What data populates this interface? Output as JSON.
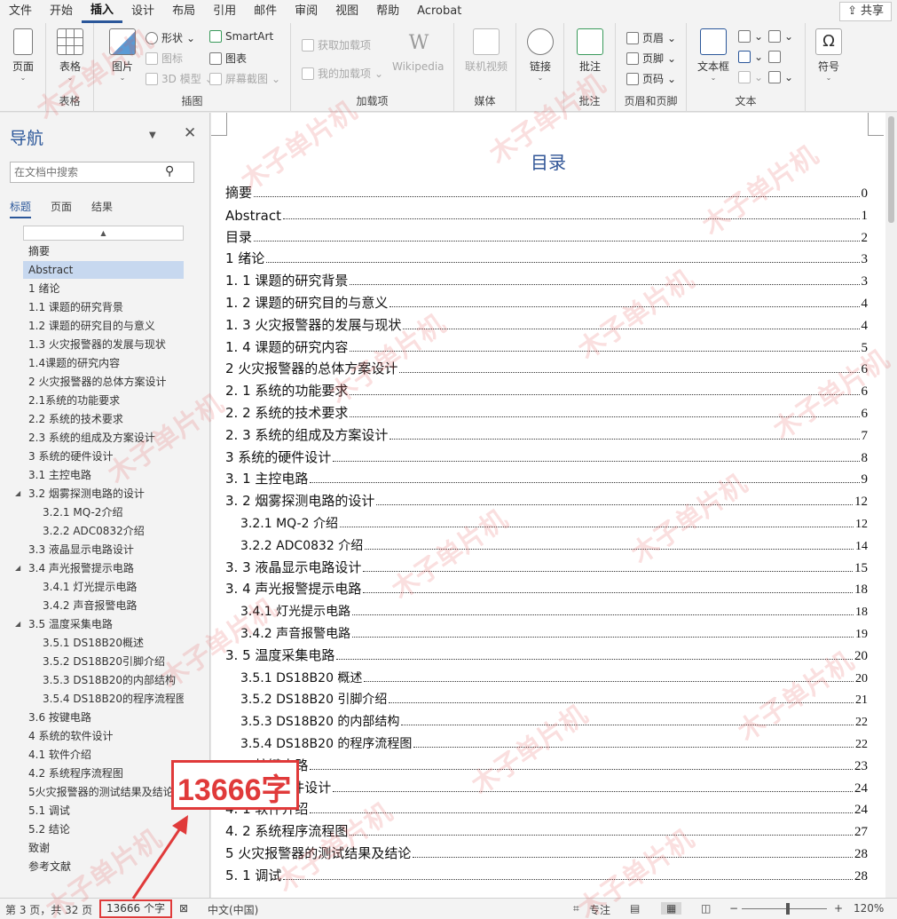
{
  "menu": {
    "items": [
      "文件",
      "开始",
      "插入",
      "设计",
      "布局",
      "引用",
      "邮件",
      "审阅",
      "视图",
      "帮助",
      "Acrobat"
    ],
    "active_index": 2,
    "share_label": "共享"
  },
  "ribbon": {
    "pages": {
      "label": "页面",
      "group": ""
    },
    "table": {
      "label": "表格",
      "group": "表格"
    },
    "picture": {
      "label": "图片"
    },
    "shapes": "形状",
    "icons": "图标",
    "model3d": "3D 模型",
    "smartart": "SmartArt",
    "chart": "图表",
    "screenshot": "屏幕截图",
    "illustrations_group": "插图",
    "get_addins": "获取加载项",
    "my_addins": "我的加载项",
    "wikipedia_logo": "W",
    "wikipedia": "Wikipedia",
    "addins_group": "加载项",
    "online_video": "联机视频",
    "media_group": "媒体",
    "link": "链接",
    "comment": "批注",
    "comment_group": "批注",
    "header": "页眉",
    "footer": "页脚",
    "page_number": "页码",
    "header_footer_group": "页眉和页脚",
    "textbox": "文本框",
    "text_group": "文本",
    "symbol": "符号",
    "symbol_glyph": "Ω"
  },
  "nav": {
    "title": "导航",
    "search_placeholder": "在文档中搜索",
    "tabs": [
      "标题",
      "页面",
      "结果"
    ],
    "items": [
      {
        "label": "摘要",
        "level": 1
      },
      {
        "label": "Abstract",
        "level": 1,
        "selected": true
      },
      {
        "label": "1 绪论",
        "level": 1
      },
      {
        "label": "1.1 课题的研究背景",
        "level": 1
      },
      {
        "label": "1.2 课题的研究目的与意义",
        "level": 1
      },
      {
        "label": "1.3 火灾报警器的发展与现状",
        "level": 1
      },
      {
        "label": "1.4课题的研究内容",
        "level": 1
      },
      {
        "label": "2 火灾报警器的总体方案设计",
        "level": 1
      },
      {
        "label": "2.1系统的功能要求",
        "level": 1
      },
      {
        "label": "2.2 系统的技术要求",
        "level": 1
      },
      {
        "label": "2.3 系统的组成及方案设计",
        "level": 1
      },
      {
        "label": "3 系统的硬件设计",
        "level": 1
      },
      {
        "label": "3.1 主控电路",
        "level": 1
      },
      {
        "label": "3.2 烟雾探测电路的设计",
        "level": 1,
        "expanded": true
      },
      {
        "label": "3.2.1 MQ-2介绍",
        "level": 2
      },
      {
        "label": "3.2.2 ADC0832介绍",
        "level": 2
      },
      {
        "label": "3.3 液晶显示电路设计",
        "level": 1
      },
      {
        "label": "3.4 声光报警提示电路",
        "level": 1,
        "expanded": true
      },
      {
        "label": "3.4.1 灯光提示电路",
        "level": 2
      },
      {
        "label": "3.4.2 声音报警电路",
        "level": 2
      },
      {
        "label": "3.5 温度采集电路",
        "level": 1,
        "expanded": true
      },
      {
        "label": "3.5.1 DS18B20概述",
        "level": 2
      },
      {
        "label": "3.5.2 DS18B20引脚介绍",
        "level": 2
      },
      {
        "label": "3.5.3 DS18B20的内部结构",
        "level": 2
      },
      {
        "label": "3.5.4 DS18B20的程序流程图",
        "level": 2
      },
      {
        "label": "3.6 按键电路",
        "level": 1
      },
      {
        "label": "4 系统的软件设计",
        "level": 1
      },
      {
        "label": "4.1 软件介绍",
        "level": 1
      },
      {
        "label": "4.2 系统程序流程图",
        "level": 1
      },
      {
        "label": "5火灾报警器的测试结果及结论",
        "level": 1
      },
      {
        "label": "5.1 调试",
        "level": 1
      },
      {
        "label": "5.2 结论",
        "level": 1
      },
      {
        "label": "致谢",
        "level": 1
      },
      {
        "label": "参考文献",
        "level": 1
      }
    ]
  },
  "document": {
    "toc_title": "目录",
    "toc": [
      {
        "text": "摘要",
        "page": "0",
        "sub": false
      },
      {
        "text": "Abstract",
        "page": "1",
        "sub": false
      },
      {
        "text": "目录",
        "page": "2",
        "sub": false
      },
      {
        "text": "1  绪论",
        "page": "3",
        "sub": false
      },
      {
        "text": "1. 1  课题的研究背景",
        "page": "3",
        "sub": false
      },
      {
        "text": "1. 2  课题的研究目的与意义",
        "page": "4",
        "sub": false
      },
      {
        "text": "1. 3  火灾报警器的发展与现状",
        "page": "4",
        "sub": false
      },
      {
        "text": "1. 4 课题的研究内容",
        "page": "5",
        "sub": false
      },
      {
        "text": "2  火灾报警器的总体方案设计",
        "page": "6",
        "sub": false
      },
      {
        "text": "2. 1 系统的功能要求",
        "page": "6",
        "sub": false
      },
      {
        "text": "2. 2  系统的技术要求",
        "page": "6",
        "sub": false
      },
      {
        "text": "2. 3  系统的组成及方案设计",
        "page": "7",
        "sub": false
      },
      {
        "text": "3  系统的硬件设计",
        "page": "8",
        "sub": false
      },
      {
        "text": "3. 1  主控电路",
        "page": "9",
        "sub": false
      },
      {
        "text": "3. 2  烟雾探测电路的设计",
        "page": "12",
        "sub": false
      },
      {
        "text": "3.2.1 MQ-2 介绍",
        "page": "12",
        "sub": true
      },
      {
        "text": "3.2.2 ADC0832 介绍",
        "page": "14",
        "sub": true
      },
      {
        "text": "3. 3  液晶显示电路设计",
        "page": "15",
        "sub": false
      },
      {
        "text": "3. 4  声光报警提示电路",
        "page": "18",
        "sub": false
      },
      {
        "text": "3.4.1  灯光提示电路",
        "page": "18",
        "sub": true
      },
      {
        "text": "3.4.2  声音报警电路",
        "page": "19",
        "sub": true
      },
      {
        "text": "3. 5  温度采集电路",
        "page": "20",
        "sub": false
      },
      {
        "text": "3.5.1 DS18B20 概述",
        "page": "20",
        "sub": true
      },
      {
        "text": "3.5.2 DS18B20 引脚介绍",
        "page": "21",
        "sub": true
      },
      {
        "text": "3.5.3 DS18B20 的内部结构",
        "page": "22",
        "sub": true
      },
      {
        "text": "3.5.4 DS18B20 的程序流程图",
        "page": "22",
        "sub": true
      },
      {
        "text": "3. 6  按键电路",
        "page": "23",
        "sub": false
      },
      {
        "text": "4  系统的软件设计",
        "page": "24",
        "sub": false
      },
      {
        "text": "4. 1  软件介绍",
        "page": "24",
        "sub": false
      },
      {
        "text": "4. 2  系统程序流程图",
        "page": "27",
        "sub": false
      },
      {
        "text": "5 火灾报警器的测试结果及结论",
        "page": "28",
        "sub": false
      },
      {
        "text": "5. 1  调试",
        "page": "28",
        "sub": false
      }
    ]
  },
  "status": {
    "page_info": "第 3 页，共 32 页",
    "word_count": "13666 个字",
    "language": "中文(中国)",
    "focus": "专注",
    "zoom_minus": "−",
    "zoom_plus": "+",
    "zoom": "120%"
  },
  "annotation": {
    "callout_text": "13666字"
  },
  "watermark": {
    "text": "木子单片机",
    "color": "#e65050"
  }
}
